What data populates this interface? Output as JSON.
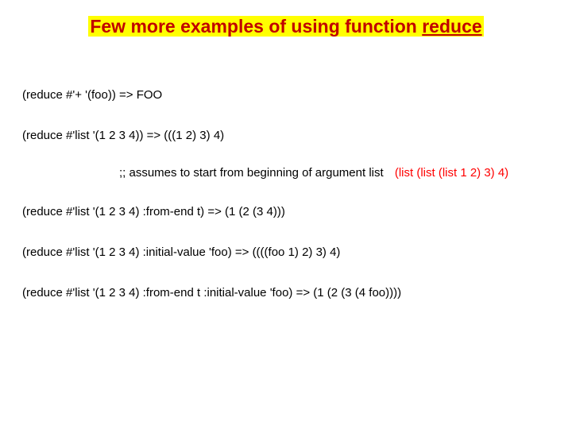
{
  "title": {
    "prefix": "Few more examples of using function ",
    "underlined": "reduce"
  },
  "lines": {
    "l1": "(reduce #'+ '(foo)) => FOO",
    "l2": "(reduce #'list '(1 2 3 4)) => (((1 2) 3) 4)",
    "comment_left": ";; assumes to start from beginning of argument list",
    "comment_right": "(list (list (list 1 2) 3) 4)",
    "l3": "(reduce #'list '(1 2 3 4) :from-end t) => (1 (2 (3 4)))",
    "l4": "(reduce #'list '(1 2 3 4) :initial-value 'foo) => ((((foo 1) 2) 3) 4)",
    "l5": "(reduce #'list '(1 2 3 4) :from-end t :initial-value 'foo) => (1 (2 (3 (4 foo))))"
  }
}
